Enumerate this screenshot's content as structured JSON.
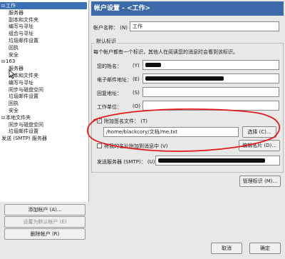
{
  "tree": {
    "items": [
      {
        "label": "工作",
        "level": 0,
        "exp": "⊟",
        "selected": true
      },
      {
        "label": "服务器",
        "level": 1
      },
      {
        "label": "副本和文件夹",
        "level": 1
      },
      {
        "label": "编写与寻址",
        "level": 1
      },
      {
        "label": "组合与寻址",
        "level": 1
      },
      {
        "label": "垃圾邮件设置",
        "level": 1
      },
      {
        "label": "回执",
        "level": 1
      },
      {
        "label": "安全",
        "level": 1
      },
      {
        "label": "163",
        "level": 0,
        "exp": "⊟"
      },
      {
        "label": "服务器",
        "level": 1
      },
      {
        "label": "副本和文件夹",
        "level": 1
      },
      {
        "label": "编写与寻址",
        "level": 1
      },
      {
        "label": "同步与磁盘空间",
        "level": 1
      },
      {
        "label": "垃圾邮件设置",
        "level": 1
      },
      {
        "label": "回执",
        "level": 1
      },
      {
        "label": "安全",
        "level": 1
      },
      {
        "label": "本地文件夹",
        "level": 0,
        "exp": "⊟"
      },
      {
        "label": "同步与磁盘空间",
        "level": 1
      },
      {
        "label": "垃圾邮件设置",
        "level": 1
      },
      {
        "label": "发送 (SMTP) 服务器",
        "level": 0
      }
    ]
  },
  "left_buttons": {
    "add_account": "添加帐户 (A)...",
    "set_default": "设置为默认帐户 (E)",
    "remove_account": "删除帐户 (R)"
  },
  "header": {
    "title": "帐户设置 - <工作>"
  },
  "account_name": {
    "label": "帐户名称： (N)",
    "value": "工作"
  },
  "identity": {
    "group_label": "默认标识",
    "description": "每个帐户都有一个标识，其他人在阅读您的消息时会看到该标识。",
    "name_label": "您的姓名：",
    "name_key": "(Y)",
    "email_label": "电子邮件地址：",
    "email_key": "(E)",
    "reply_label": "回复地址：",
    "reply_key": "(S)",
    "org_label": "工作单位：",
    "org_key": "(O)",
    "signature_label": "附加签名文件： (T)",
    "signature_path": "/home/blackcory/文档/me.txt",
    "choose_button": "选择 (C)...",
    "vcard_label": "将我的名片附加到消息中 (V)",
    "edit_card_button": "编辑名片 (D)...",
    "smtp_label": "发送服务器 (SMTP)： (U)",
    "manage_identity_button": "管理标识 (M)..."
  },
  "footer": {
    "cancel": "取消",
    "ok": "确定"
  },
  "colors": {
    "header_bg": "#3c6aa8",
    "selection": "#3b6fb6",
    "annotation": "#e21a1a"
  }
}
